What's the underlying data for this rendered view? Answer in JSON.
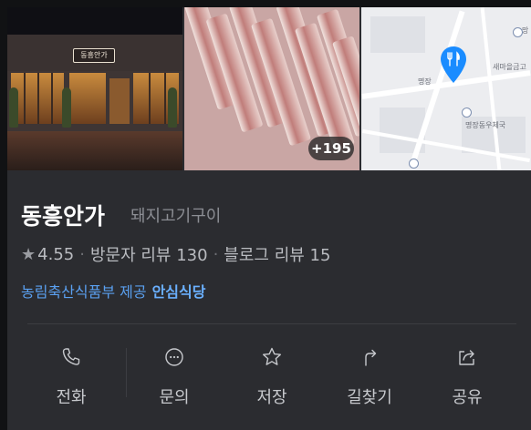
{
  "photos": {
    "storefront_sign": "동흥안가",
    "more_count": "+195",
    "map_labels": [
      "망",
      "새마을금고",
      "명장",
      "명장동우체국"
    ]
  },
  "place": {
    "name": "동흥안가",
    "category": "돼지고기구이",
    "rating": "4.55",
    "visitor_reviews": "방문자 리뷰 130",
    "blog_reviews": "블로그 리뷰 15",
    "provider": "농림축산식품부 제공",
    "certification": "안심식당"
  },
  "actions": [
    {
      "label": "전화",
      "icon": "phone-icon"
    },
    {
      "label": "문의",
      "icon": "chat-icon"
    },
    {
      "label": "저장",
      "icon": "star-icon"
    },
    {
      "label": "길찾기",
      "icon": "directions-icon"
    },
    {
      "label": "공유",
      "icon": "share-icon"
    }
  ],
  "colors": {
    "background": "#2b2c30",
    "link": "#5aa0f0",
    "map_pin": "#1a8cff"
  }
}
